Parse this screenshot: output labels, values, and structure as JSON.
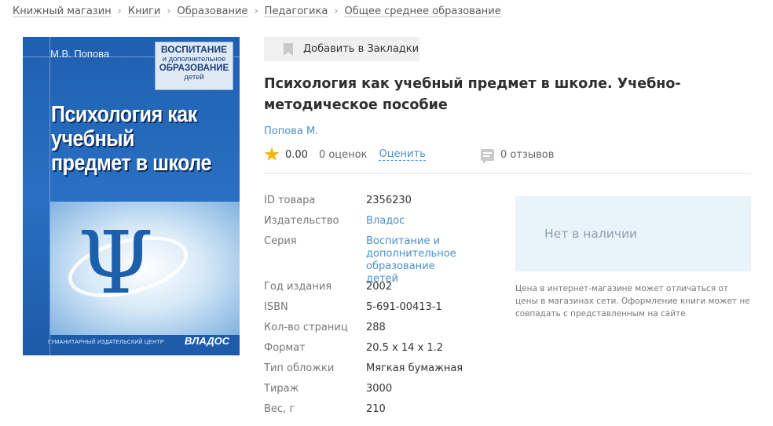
{
  "breadcrumb": {
    "items": [
      "Книжный магазин",
      "Книги",
      "Образование",
      "Педагогика",
      "Общее среднее образование"
    ],
    "separator": "›"
  },
  "cover": {
    "author": "М.В. Попова",
    "series_line1": "ВОСПИТАНИЕ",
    "series_line2": "и дополнительное",
    "series_line3": "ОБРАЗОВАНИЕ",
    "series_line4": "детей",
    "title": "Психология как учебный предмет в школе",
    "symbol": "Ψ",
    "publisher_line": "ГУМАНИТАРНЫЙ ИЗДАТЕЛЬСКИЙ ЦЕНТР",
    "logo": "ВЛАДОС"
  },
  "bookmark": {
    "label": "Добавить в Закладки"
  },
  "book": {
    "title": "Психология как учебный предмет в школе. Учебно-методическое пособие",
    "author": "Попова М."
  },
  "rating": {
    "value": "0.00",
    "count_text": "0 оценок",
    "rate_label": "Оценить",
    "reviews_text": "0 отзывов"
  },
  "specs": [
    {
      "label": "ID товара",
      "value": "2356230"
    },
    {
      "label": "Издательство",
      "value": "Владос"
    },
    {
      "label": "Серия",
      "value": "Воспитание и дополнительное образование детей"
    },
    {
      "label": "Год издания",
      "value": "2002"
    },
    {
      "label": "ISBN",
      "value": "5-691-00413-1"
    },
    {
      "label": "Кол-во страниц",
      "value": "288"
    },
    {
      "label": "Формат",
      "value": "20.5 x 14 x 1.2"
    },
    {
      "label": "Тип обложки",
      "value": "Мягкая бумажная"
    },
    {
      "label": "Тираж",
      "value": "3000"
    },
    {
      "label": "Вес, г",
      "value": "210"
    }
  ],
  "availability": {
    "status": "Нет в наличии",
    "note": "Цена в интернет-магазине может отличаться от цены в магазинах сети. Оформление книги может не совпадать с представленным на сайте"
  },
  "colors": {
    "link": "#4a90c9",
    "star": "#f5b400",
    "cover_blue": "#2a6fc2",
    "availability_bg": "#e8f3fa"
  }
}
